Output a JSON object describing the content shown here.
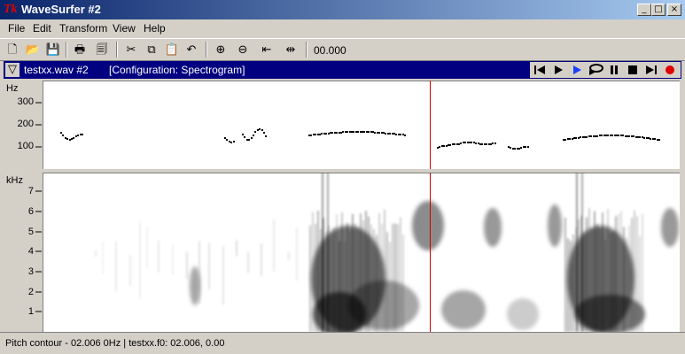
{
  "window": {
    "title": "WaveSurfer #2",
    "app_icon": "Tk",
    "minimize": "_",
    "maximize": "□",
    "close": "×"
  },
  "menu": {
    "items": [
      "File",
      "Edit",
      "Transform",
      "View",
      "Help"
    ]
  },
  "toolbar": {
    "buttons": [
      {
        "name": "new-file-icon",
        "glyph": "🗋"
      },
      {
        "name": "open-folder-icon",
        "glyph": "📂"
      },
      {
        "name": "save-icon",
        "glyph": "💾"
      },
      {
        "name": "print-icon",
        "glyph": "🖶"
      },
      {
        "name": "properties-icon",
        "glyph": "🗐"
      },
      {
        "name": "cut-icon",
        "glyph": "✂"
      },
      {
        "name": "copy-icon",
        "glyph": "⧉"
      },
      {
        "name": "paste-icon",
        "glyph": "📋"
      },
      {
        "name": "undo-icon",
        "glyph": "↶"
      },
      {
        "name": "zoom-in-icon",
        "glyph": "⊕"
      },
      {
        "name": "zoom-out-icon",
        "glyph": "⊖"
      },
      {
        "name": "zoom-to-selection-icon",
        "glyph": "⇤"
      },
      {
        "name": "zoom-fit-icon",
        "glyph": "⇹"
      }
    ],
    "time": "00.000"
  },
  "sound": {
    "filename": "testxx.wav #2",
    "configuration": "[Configuration: Spectrogram]",
    "collapse_glyph": "▽"
  },
  "playback": {
    "buttons": [
      "skip-to-start",
      "play",
      "play-selection",
      "play-loop",
      "pause",
      "stop",
      "skip-to-end",
      "record"
    ],
    "colors": {
      "play_selection": "#1a3dff",
      "record": "#e00000"
    }
  },
  "pitch_pane": {
    "unit": "Hz",
    "ticks": [
      "300",
      "200",
      "100"
    ]
  },
  "spectrogram_pane": {
    "unit": "kHz",
    "ticks": [
      "7",
      "6",
      "5",
      "4",
      "3",
      "2",
      "1"
    ]
  },
  "cursor": {
    "color": "#cc0000"
  },
  "status": {
    "text": "Pitch contour - 02.006 0Hz | testxx.f0: 02.006, 0.00"
  }
}
